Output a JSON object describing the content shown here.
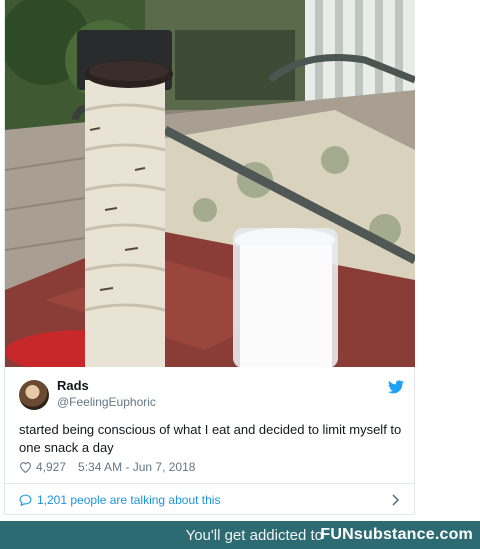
{
  "tweet": {
    "author_name": "Rads",
    "author_handle": "@FeelingEuphoric",
    "text": "started being conscious of what I eat and decided to limit myself to one snack a day",
    "likes": "4,927",
    "timestamp": "5:34 AM - Jun 7, 2018",
    "conversation": "1,201 people are talking about this"
  },
  "icons": {
    "platform": "twitter-bird-icon",
    "like": "heart-icon",
    "reply": "speech-bubble-icon",
    "more": "chevron-right-icon"
  },
  "colors": {
    "link_blue": "#1b95e0",
    "muted": "#657786",
    "footer_bg": "#2d6b73"
  },
  "footer": {
    "tagline": "You'll get addicted to",
    "brand": "FUNsubstance.com"
  }
}
